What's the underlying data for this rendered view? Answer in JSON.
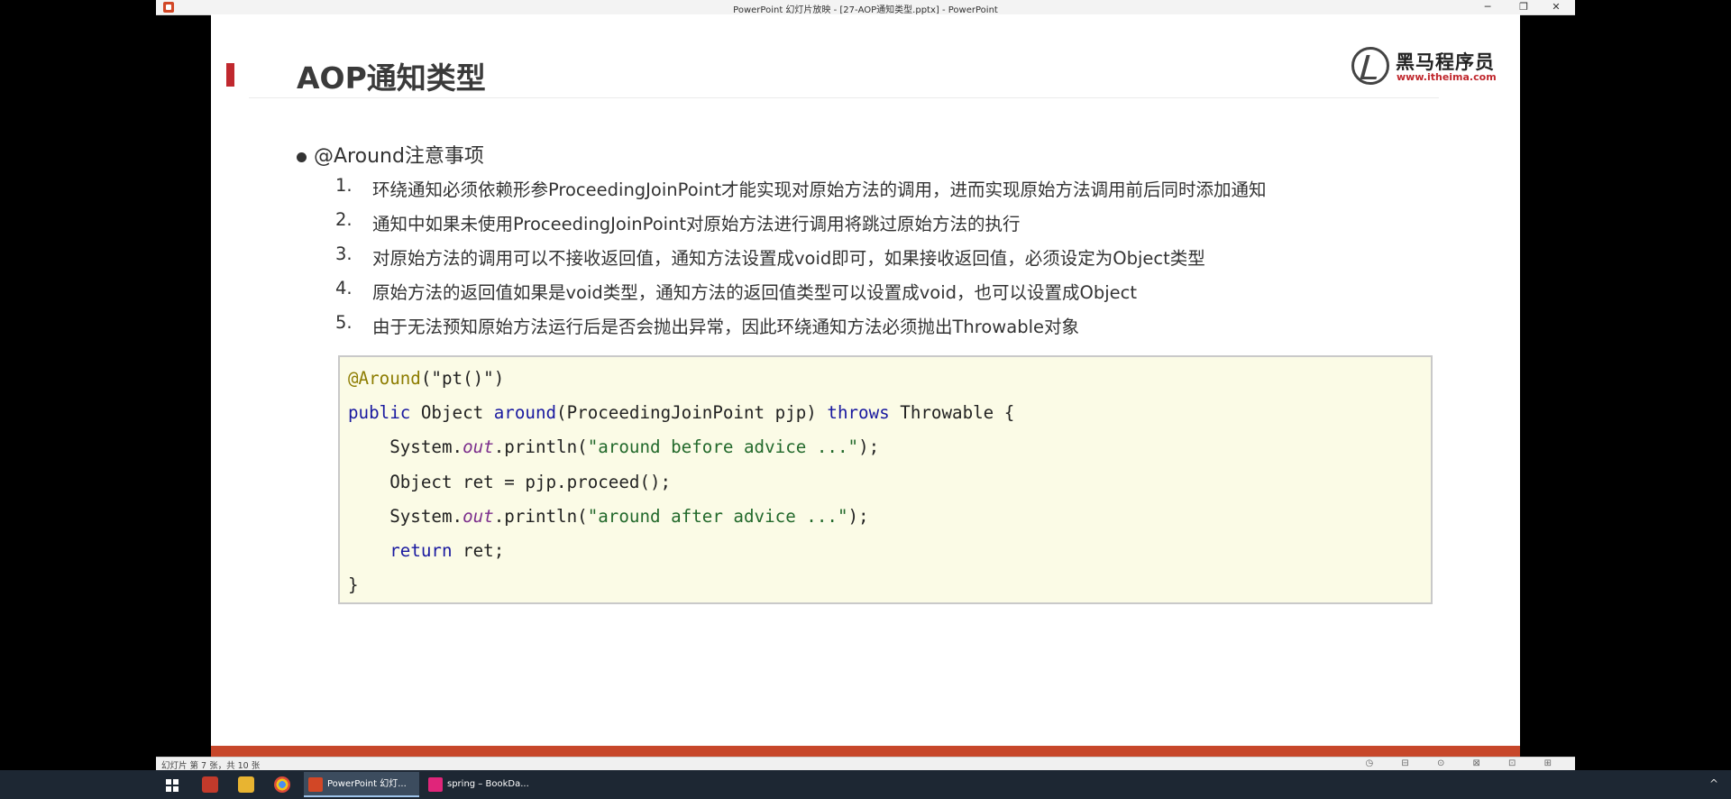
{
  "window": {
    "title": "PowerPoint 幻灯片放映 - [27-AOP通知类型.pptx] - PowerPoint",
    "minimize_label": "─",
    "restore_label": "❐",
    "close_label": "✕"
  },
  "slide": {
    "title": "AOP通知类型",
    "logo": {
      "cn": "黑马程序员",
      "url": "www.itheima.com"
    },
    "bullet": "@Around注意事项",
    "items": [
      {
        "num": "1.",
        "text": "环绕通知必须依赖形参ProceedingJoinPoint才能实现对原始方法的调用，进而实现原始方法调用前后同时添加通知"
      },
      {
        "num": "2.",
        "text": "通知中如果未使用ProceedingJoinPoint对原始方法进行调用将跳过原始方法的执行"
      },
      {
        "num": "3.",
        "text": "对原始方法的调用可以不接收返回值，通知方法设置成void即可，如果接收返回值，必须设定为Object类型"
      },
      {
        "num": "4.",
        "text": "原始方法的返回值如果是void类型，通知方法的返回值类型可以设置成void，也可以设置成Object"
      },
      {
        "num": "5.",
        "text": "由于无法预知原始方法运行后是否会抛出异常，因此环绕通知方法必须抛出Throwable对象"
      }
    ],
    "code": {
      "l1_ann": "@Around",
      "l1_rest": "(\"pt()\")",
      "l2_kw1": "public",
      "l2_a": " Object ",
      "l2_fn": "around",
      "l2_b": "(ProceedingJoinPoint pjp) ",
      "l2_kw2": "throws",
      "l2_c": " Throwable {",
      "l3_a": "    System.",
      "l3_out": "out",
      "l3_b": ".println(",
      "l3_str": "\"around before advice ...\"",
      "l3_c": ");",
      "l4": "    Object ret = pjp.proceed();",
      "l5_a": "    System.",
      "l5_out": "out",
      "l5_b": ".println(",
      "l5_str": "\"around after advice ...\"",
      "l5_c": ");",
      "l6_ind": "    ",
      "l6_kw": "return",
      "l6_rest": " ret;",
      "l7": "}"
    }
  },
  "statusbar": {
    "slide_info": "幻灯片 第 7 张，共 10 张",
    "icons": "◷ ⊟ ⊙ ⊠ ⊡ ⊞"
  },
  "taskbar": {
    "tasks": [
      {
        "label": "PowerPoint 幻灯...",
        "icon_color": "#d24726"
      },
      {
        "label": "spring – BookDa...",
        "icon_color": "#e0257a"
      }
    ],
    "tray": "^"
  },
  "colors": {
    "accent_red": "#c0282e",
    "code_bg": "#fbfbe6",
    "taskbar": "#1d2733"
  }
}
